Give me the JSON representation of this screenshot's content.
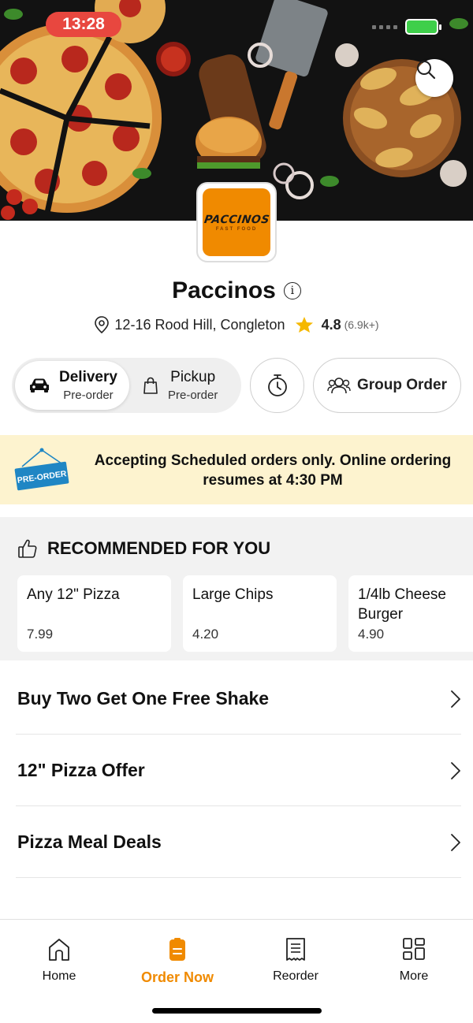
{
  "status_bar": {
    "time": "13:28"
  },
  "restaurant": {
    "logo_text": "PACCINOS",
    "logo_subtext": "FAST FOOD",
    "name": "Paccinos",
    "address": "12-16 Rood Hill, Congleton",
    "rating": "4.8",
    "rating_count": "(6.9k+)"
  },
  "order_type": {
    "options": [
      {
        "label": "Delivery",
        "sub": "Pre-order",
        "icon": "car-icon",
        "selected": true
      },
      {
        "label": "Pickup",
        "sub": "Pre-order",
        "icon": "bag-icon",
        "selected": false
      }
    ],
    "group_order_label": "Group Order"
  },
  "banner": {
    "sign_text": "PRE-ORDER",
    "message": "Accepting Scheduled orders only. Online ordering resumes at 4:30 PM"
  },
  "recommended": {
    "title": "RECOMMENDED FOR YOU",
    "items": [
      {
        "name": "Any 12\" Pizza",
        "price": "7.99"
      },
      {
        "name": "Large Chips",
        "price": "4.20"
      },
      {
        "name": "1/4lb Cheese Burger",
        "price": "4.90"
      }
    ]
  },
  "offers": [
    {
      "title": "Buy Two Get One Free Shake"
    },
    {
      "title": "12\" Pizza Offer"
    },
    {
      "title": "Pizza Meal Deals"
    }
  ],
  "bottom_nav": [
    {
      "label": "Home",
      "icon": "home-icon",
      "active": false
    },
    {
      "label": "Order Now",
      "icon": "order-icon",
      "active": true
    },
    {
      "label": "Reorder",
      "icon": "receipt-icon",
      "active": false
    },
    {
      "label": "More",
      "icon": "grid-icon",
      "active": false
    }
  ],
  "colors": {
    "accent": "#f08a00",
    "banner_bg": "#fdf3cf",
    "status_time_bg": "#e8473f",
    "star": "#f5b800"
  }
}
